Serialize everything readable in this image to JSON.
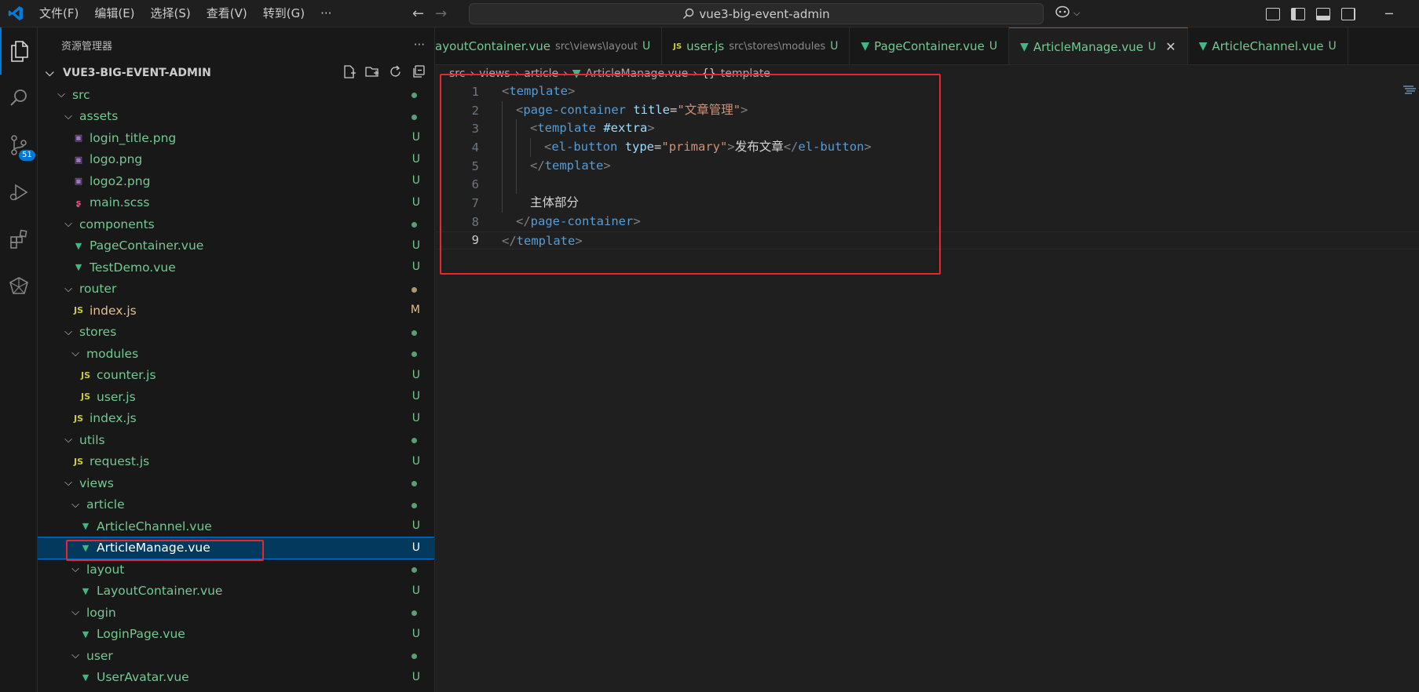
{
  "titlebar": {
    "menu": [
      "文件(F)",
      "编辑(E)",
      "选择(S)",
      "查看(V)",
      "转到(G)"
    ],
    "more": "···",
    "search_text": "vue3-big-event-admin"
  },
  "activity": {
    "scm_badge": "51"
  },
  "sidebar": {
    "title": "资源管理器",
    "more": "···",
    "project": "VUE3-BIG-EVENT-ADMIN",
    "tree": [
      {
        "depth": 1,
        "type": "folder",
        "name": "src",
        "status": "dot"
      },
      {
        "depth": 2,
        "type": "folder",
        "name": "assets",
        "status": "dot"
      },
      {
        "depth": 3,
        "type": "img",
        "name": "login_title.png",
        "status": "U"
      },
      {
        "depth": 3,
        "type": "img",
        "name": "logo.png",
        "status": "U"
      },
      {
        "depth": 3,
        "type": "img",
        "name": "logo2.png",
        "status": "U"
      },
      {
        "depth": 3,
        "type": "scss",
        "name": "main.scss",
        "status": "U"
      },
      {
        "depth": 2,
        "type": "folder",
        "name": "components",
        "status": "dot"
      },
      {
        "depth": 3,
        "type": "vue",
        "name": "PageContainer.vue",
        "status": "U"
      },
      {
        "depth": 3,
        "type": "vue",
        "name": "TestDemo.vue",
        "status": "U"
      },
      {
        "depth": 2,
        "type": "folder",
        "name": "router",
        "status": "dotmod"
      },
      {
        "depth": 3,
        "type": "js",
        "name": "index.js",
        "status": "M"
      },
      {
        "depth": 2,
        "type": "folder",
        "name": "stores",
        "status": "dot"
      },
      {
        "depth": 3,
        "type": "folder",
        "name": "modules",
        "status": "dot"
      },
      {
        "depth": 4,
        "type": "js",
        "name": "counter.js",
        "status": "U"
      },
      {
        "depth": 4,
        "type": "js",
        "name": "user.js",
        "status": "U"
      },
      {
        "depth": 3,
        "type": "js",
        "name": "index.js",
        "status": "U"
      },
      {
        "depth": 2,
        "type": "folder",
        "name": "utils",
        "status": "dot"
      },
      {
        "depth": 3,
        "type": "js",
        "name": "request.js",
        "status": "U"
      },
      {
        "depth": 2,
        "type": "folder",
        "name": "views",
        "status": "dot"
      },
      {
        "depth": 3,
        "type": "folder",
        "name": "article",
        "status": "dot"
      },
      {
        "depth": 4,
        "type": "vue",
        "name": "ArticleChannel.vue",
        "status": "U"
      },
      {
        "depth": 4,
        "type": "vue",
        "name": "ArticleManage.vue",
        "status": "U",
        "selected": true
      },
      {
        "depth": 3,
        "type": "folder",
        "name": "layout",
        "status": "dot"
      },
      {
        "depth": 4,
        "type": "vue",
        "name": "LayoutContainer.vue",
        "status": "U"
      },
      {
        "depth": 3,
        "type": "folder",
        "name": "login",
        "status": "dot"
      },
      {
        "depth": 4,
        "type": "vue",
        "name": "LoginPage.vue",
        "status": "U"
      },
      {
        "depth": 3,
        "type": "folder",
        "name": "user",
        "status": "dot"
      },
      {
        "depth": 4,
        "type": "vue",
        "name": "UserAvatar.vue",
        "status": "U"
      }
    ]
  },
  "tabs": [
    {
      "icon": "vue",
      "name": "ayoutContainer.vue",
      "path": "src\\views\\layout",
      "status": "U"
    },
    {
      "icon": "js",
      "name": "user.js",
      "path": "src\\stores\\modules",
      "status": "U"
    },
    {
      "icon": "vue",
      "name": "PageContainer.vue",
      "path": "",
      "status": "U"
    },
    {
      "icon": "vue",
      "name": "ArticleManage.vue",
      "path": "",
      "status": "U",
      "active": true
    },
    {
      "icon": "vue",
      "name": "ArticleChannel.vue",
      "path": "",
      "status": "U"
    }
  ],
  "breadcrumb": {
    "seg1": "src",
    "seg2": "views",
    "seg3": "article",
    "seg4": "ArticleManage.vue",
    "seg5_icon": "{}",
    "seg5": "template"
  },
  "code": {
    "line_numbers": [
      "1",
      "2",
      "3",
      "4",
      "5",
      "6",
      "7",
      "8",
      "9"
    ],
    "l1": {
      "open": "<",
      "tag": "template",
      "close": ">"
    },
    "l2": {
      "open": "<",
      "tag": "page-container",
      "attr": "title",
      "eq": "=",
      "val": "\"文章管理\"",
      "close": ">"
    },
    "l3": {
      "open": "<",
      "tag": "template",
      "attr": "#extra",
      "close": ">"
    },
    "l4": {
      "open": "<",
      "tag": "el-button",
      "attr": "type",
      "eq": "=",
      "val": "\"primary\"",
      "close": ">",
      "text": "发布文章",
      "eopen": "</",
      "etag": "el-button",
      "eclose": ">"
    },
    "l5": {
      "open": "</",
      "tag": "template",
      "close": ">"
    },
    "l7": {
      "text": "主体部分"
    },
    "l8": {
      "open": "</",
      "tag": "page-container",
      "close": ">"
    },
    "l9": {
      "open": "</",
      "tag": "template",
      "close": ">"
    }
  },
  "colors": {
    "accent": "#0078d4",
    "highlight_box": "#e8262b",
    "untracked": "#73c991",
    "modified": "#e2c08d"
  }
}
